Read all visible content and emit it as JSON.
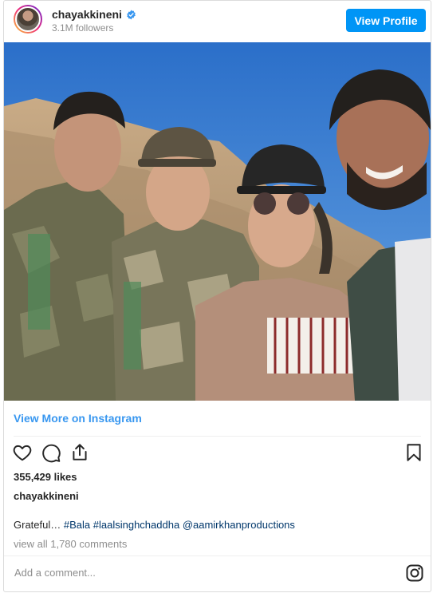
{
  "header": {
    "username": "chayakkineni",
    "followers": "3.1M followers",
    "view_profile_label": "View Profile"
  },
  "post": {
    "view_more_label": "View More on Instagram",
    "likes": "355,429 likes",
    "caption_user": "chayakkineni",
    "caption_prefix": "Grateful…",
    "caption_tags": [
      "#Bala",
      "#laalsinghchaddha",
      "@aamirkhanproductions"
    ],
    "comments_link": "view all 1,780 comments"
  },
  "comment_box": {
    "placeholder": "Add a comment..."
  },
  "icons": {
    "verified": "verified-badge-icon",
    "like": "heart-icon",
    "comment": "comment-icon",
    "share": "share-icon",
    "save": "bookmark-icon",
    "brand": "instagram-icon"
  },
  "colors": {
    "accent": "#0095f6",
    "link": "#3897f0",
    "tag": "#00376b",
    "muted": "#8e8e8e"
  }
}
